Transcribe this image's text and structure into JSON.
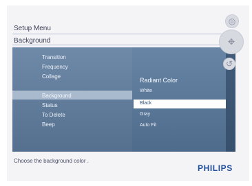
{
  "header": {
    "title": "Setup Menu",
    "subtitle": "Background"
  },
  "menu": {
    "items": [
      "Transition",
      "Frequency",
      "Collage",
      "Background",
      "Status",
      "To Delete",
      "Beep"
    ],
    "selected": "Background"
  },
  "submenu": {
    "title": "Radiant Color",
    "options": [
      "White",
      "Black",
      "Gray",
      "Auto Fit"
    ],
    "selected": "Black"
  },
  "footer": {
    "instruction": "Choose the background color .",
    "brand": "PHILIPS"
  },
  "controls": {
    "top_icon": "settings-icon",
    "middle_icon": "navigation-pad-icon",
    "bottom_icon": "back-icon"
  }
}
